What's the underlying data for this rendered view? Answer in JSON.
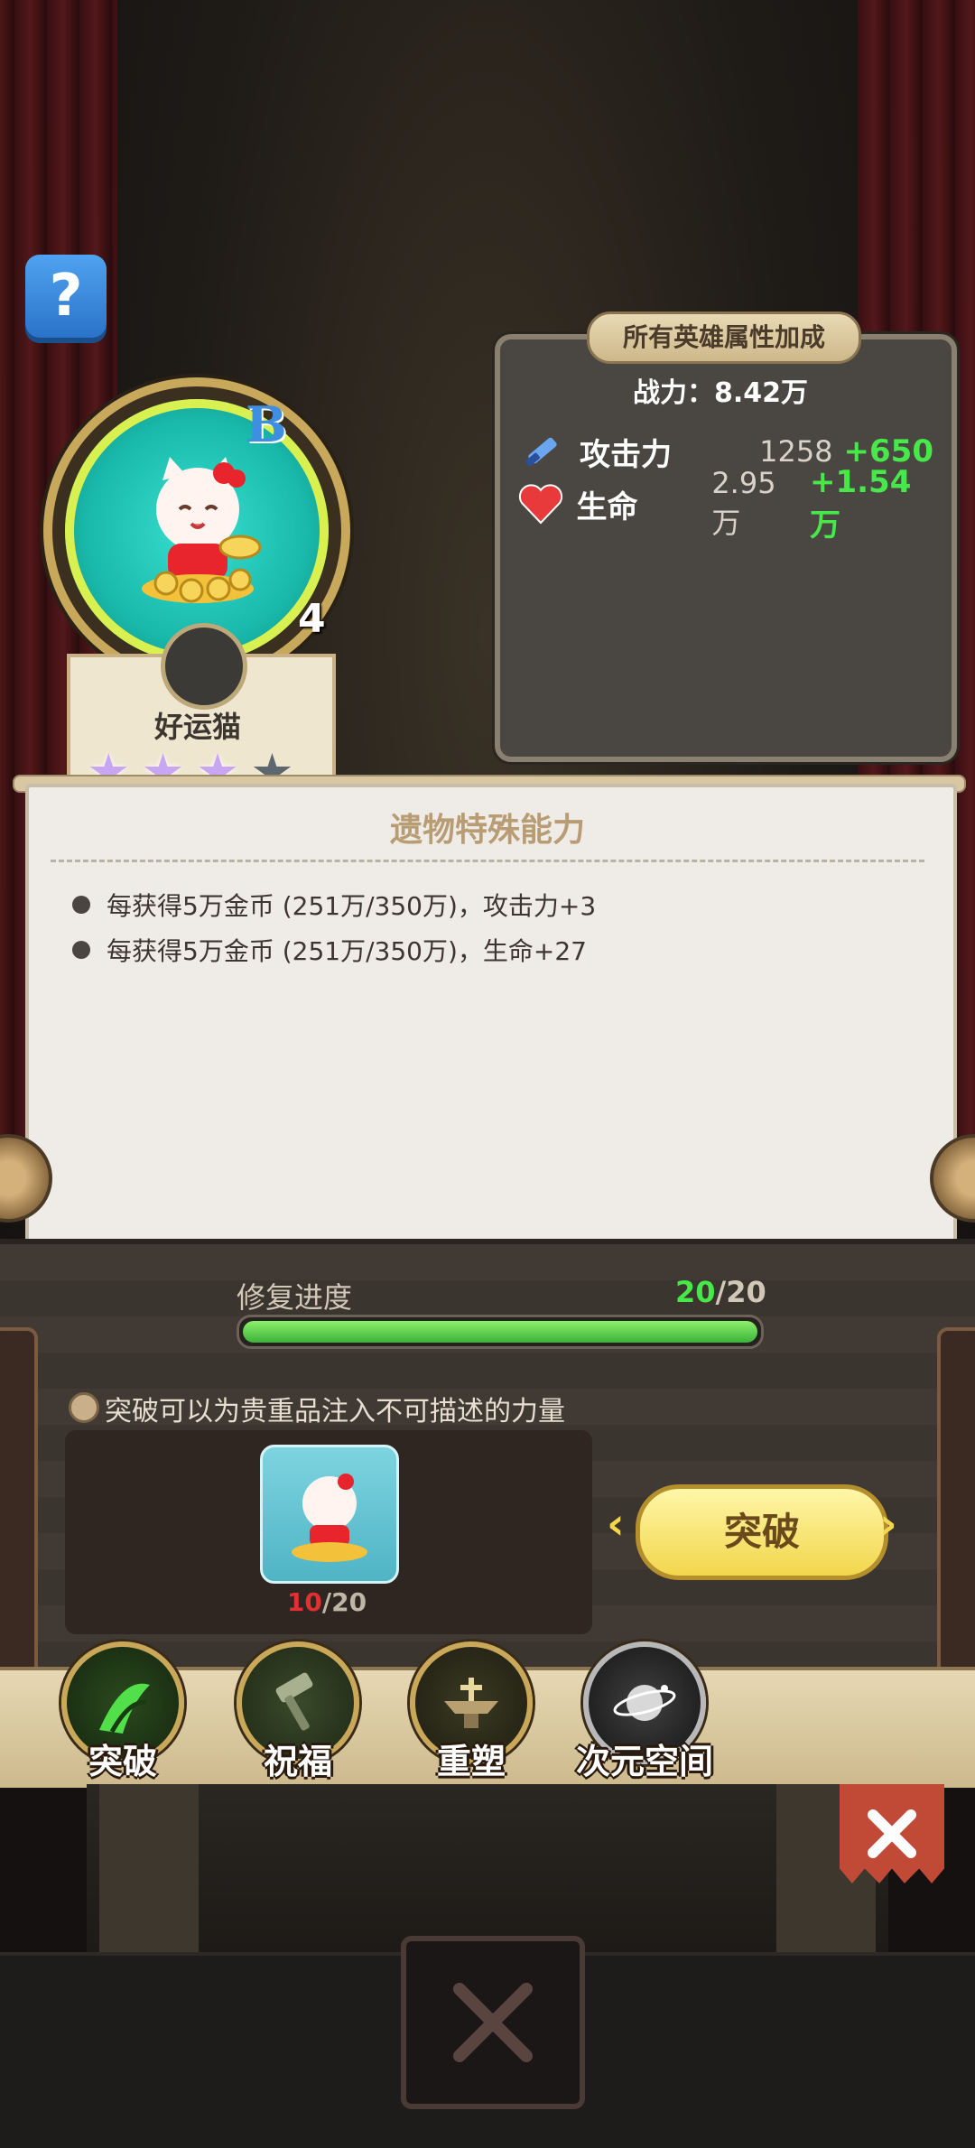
{
  "hero": {
    "name": "好运猫",
    "grade": "B",
    "level": "4",
    "stars_filled": 3,
    "stars_total": 4
  },
  "stats_panel": {
    "tag": "所有英雄属性加成",
    "power": "战力：8.42万",
    "attack": {
      "label": "攻击力",
      "base": "1258",
      "bonus": "+650"
    },
    "life": {
      "label": "生命",
      "base": "2.95万",
      "bonus": "+1.54万"
    }
  },
  "ability": {
    "title": "遗物特殊能力",
    "items": [
      "每获得5万金币 (251万/350万)，攻击力+3",
      "每获得5万金币 (251万/350万)，生命+27"
    ]
  },
  "repair": {
    "label": "修复进度",
    "current": "20",
    "total": "/20",
    "fraction": 1.0
  },
  "breakthrough": {
    "hint": "突破可以为贵重品注入不可描述的力量",
    "material_current": "10",
    "material_total": "/20",
    "button_label": "突破",
    "arrow_left": "‹",
    "arrow_right": "›"
  },
  "tabs": [
    {
      "label": "突破",
      "icon": "claw-icon"
    },
    {
      "label": "祝福",
      "icon": "hammer-icon"
    },
    {
      "label": "重塑",
      "icon": "anvil-icon"
    },
    {
      "label": "次元空间",
      "icon": "planet-icon"
    }
  ],
  "help_label": "?",
  "colors": {
    "bonus_green": "#47e84a",
    "deficit_red": "#e03030",
    "button_yellow": "#f2d64c",
    "close_red": "#c14a36"
  }
}
